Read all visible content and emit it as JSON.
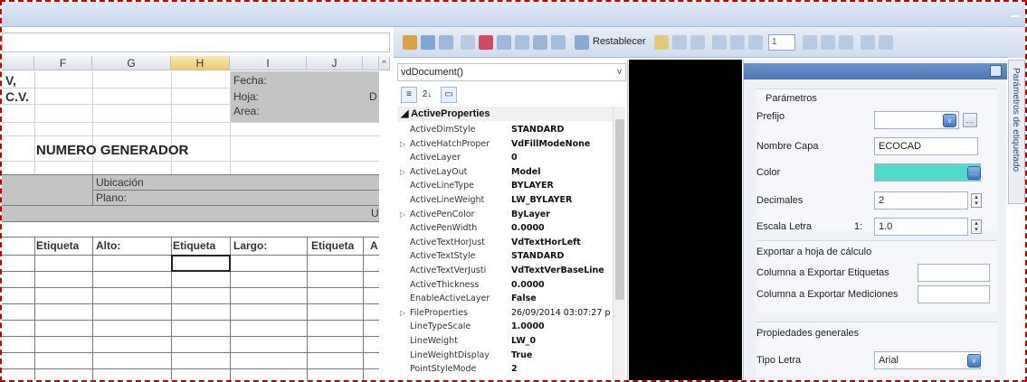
{
  "sheet": {
    "columns": [
      "F",
      "G",
      "H",
      "I",
      "J"
    ],
    "selected_column": "H",
    "company_partial": [
      "V,",
      "C.V."
    ],
    "fecha_label": "Fecha:",
    "hoja_label": "Hoja:",
    "hoja_suffix": "D",
    "area_label": "Area:",
    "title": "NUMERO GENERADOR",
    "ubicacion_label": "Ubicación",
    "plano_label": "Plano:",
    "u_fragment": "U",
    "headers": [
      "Etiqueta",
      "Alto:",
      "Etiqueta",
      "Largo:",
      "Etiqueta",
      "A"
    ]
  },
  "toolbar": {
    "restablecer_label": "Restablecer",
    "spin_value": "1"
  },
  "propgrid": {
    "object_selector": "vdDocument()",
    "category": "ActiveProperties",
    "rows": [
      {
        "name": "ActiveDimStyle",
        "value": "STANDARD",
        "expand": false,
        "bold": true
      },
      {
        "name": "ActiveHatchProper",
        "value": "VdFillModeNone",
        "expand": true,
        "bold": true
      },
      {
        "name": "ActiveLayer",
        "value": "0",
        "expand": false,
        "bold": true
      },
      {
        "name": "ActiveLayOut",
        "value": "Model",
        "expand": true,
        "bold": true
      },
      {
        "name": "ActiveLineType",
        "value": "BYLAYER",
        "expand": false,
        "bold": true
      },
      {
        "name": "ActiveLineWeight",
        "value": "LW_BYLAYER",
        "expand": false,
        "bold": true
      },
      {
        "name": "ActivePenColor",
        "value": "ByLayer",
        "expand": true,
        "bold": true
      },
      {
        "name": "ActivePenWidth",
        "value": "0.0000",
        "expand": false,
        "bold": true
      },
      {
        "name": "ActiveTextHorJust",
        "value": "VdTextHorLeft",
        "expand": false,
        "bold": true
      },
      {
        "name": "ActiveTextStyle",
        "value": "STANDARD",
        "expand": false,
        "bold": true
      },
      {
        "name": "ActiveTextVerJusti",
        "value": "VdTextVerBaseLine",
        "expand": false,
        "bold": true
      },
      {
        "name": "ActiveThickness",
        "value": "0.0000",
        "expand": false,
        "bold": true
      },
      {
        "name": "EnableActiveLayer",
        "value": "False",
        "expand": false,
        "bold": true
      },
      {
        "name": "FileProperties",
        "value": "26/09/2014 03:07:27 p",
        "expand": true,
        "bold": false
      },
      {
        "name": "LineTypeScale",
        "value": "1.0000",
        "expand": false,
        "bold": true
      },
      {
        "name": "LineWeight",
        "value": "LW_0",
        "expand": false,
        "bold": true
      },
      {
        "name": "LineWeightDisplay",
        "value": "True",
        "expand": false,
        "bold": true
      },
      {
        "name": "PointStyleMode",
        "value": "2",
        "expand": false,
        "bold": true
      }
    ]
  },
  "labelpanel": {
    "parametros": {
      "title": "Parámetros",
      "prefijo_label": "Prefijo",
      "prefijo_value": "",
      "nombre_capa_label": "Nombre Capa",
      "nombre_capa_value": "ECOCAD",
      "color_label": "Color",
      "color_value": "#4fd9c6",
      "decimales_label": "Decimales",
      "decimales_value": "2",
      "escala_label": "Escala Letra",
      "escala_prefix": "1:",
      "escala_value": "1.0"
    },
    "exportar": {
      "title": "Exportar a hoja de cálculo",
      "col_etiquetas_label": "Columna a Exportar Etiquetas",
      "col_etiquetas_value": "",
      "col_mediciones_label": "Columna a Exportar Mediciones",
      "col_mediciones_value": ""
    },
    "propiedades": {
      "title": "Propiedades generales",
      "tipo_letra_label": "Tipo Letra",
      "tipo_letra_value": "Arial"
    },
    "side_tab": "Parámetros de etiquetado"
  }
}
